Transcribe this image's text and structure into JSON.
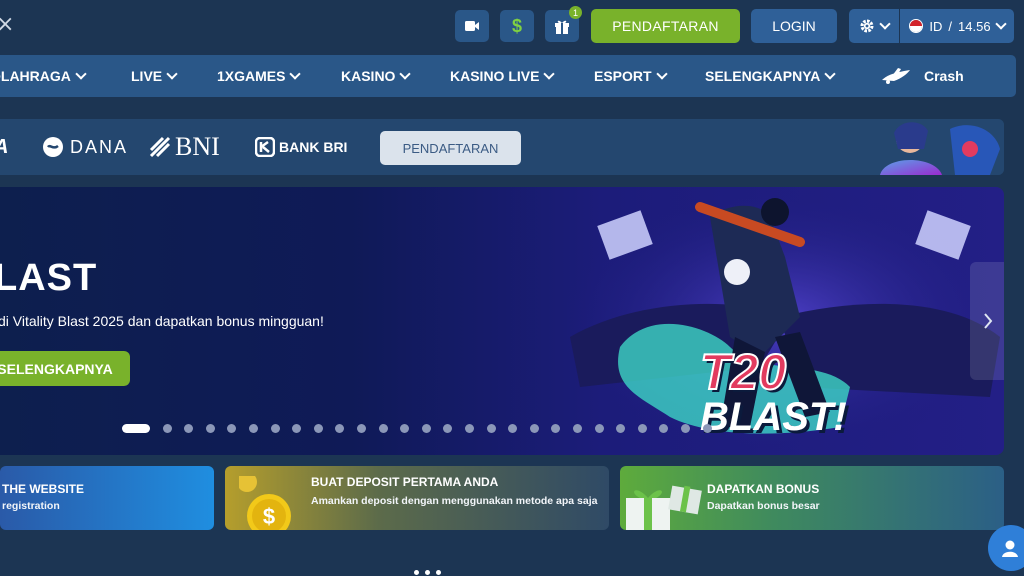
{
  "header": {
    "close_label": "×",
    "register_label": "PENDAFTARAN",
    "login_label": "LOGIN",
    "gift_badge": "1",
    "dollar_label": "$",
    "language": "ID",
    "time": "14.56",
    "lang_separator": "/"
  },
  "nav": {
    "items": [
      {
        "label": "OLAHRAGA"
      },
      {
        "label": "LIVE"
      },
      {
        "label": "1XGAMES"
      },
      {
        "label": "KASINO"
      },
      {
        "label": "KASINO LIVE"
      },
      {
        "label": "ESPORT"
      },
      {
        "label": "SELENGKAPNYA"
      }
    ],
    "crash_label": "Crash"
  },
  "payments": {
    "items": [
      "A",
      "DANA",
      "BNI",
      "BANK BRI"
    ],
    "register_label": "PENDAFTARAN"
  },
  "banner": {
    "title": "LAST",
    "subtitle": "di Vitality Blast 2025 dan dapatkan bonus mingguan!",
    "button_label": "SELENGKAPNYA",
    "art_line1": "T20",
    "art_line2": "BLAST!",
    "slide_count": 27,
    "active_slide": 1
  },
  "promos": [
    {
      "title": "THE WEBSITE",
      "subtitle": "registration"
    },
    {
      "title": "BUAT DEPOSIT PERTAMA ANDA",
      "subtitle": "Amankan deposit dengan menggunakan metode apa saja"
    },
    {
      "title": "DAPATKAN BONUS",
      "subtitle": "Dapatkan bonus besar"
    }
  ],
  "colors": {
    "accent_green": "#79b22b",
    "primary_blue": "#2f6098",
    "background": "#1c3553"
  }
}
